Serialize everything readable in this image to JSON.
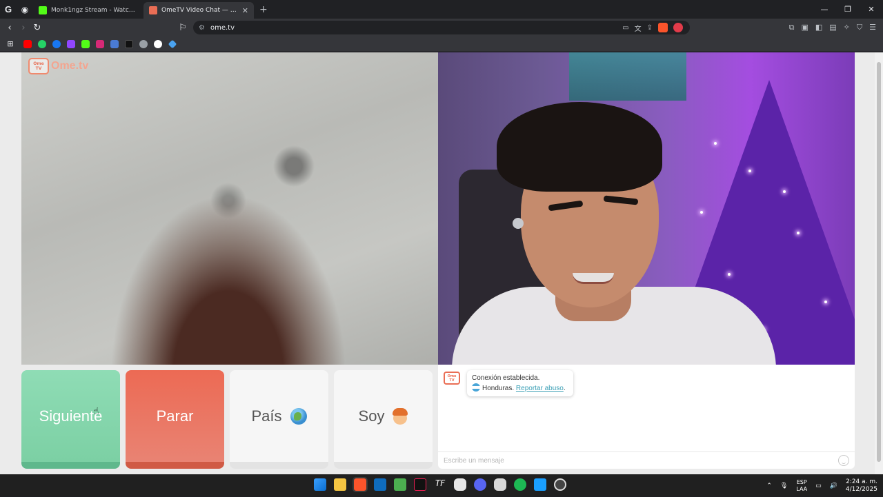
{
  "browser": {
    "tabs": [
      {
        "title": "Monk1ngz Stream - Watch Live o",
        "active": false
      },
      {
        "title": "OmeTV Video Chat — Omegl",
        "active": true
      }
    ],
    "new_tab_symbol": "+",
    "url": "ome.tv"
  },
  "ometv": {
    "logo_small": "Ome TV",
    "logo_text": "Ome.tv",
    "buttons": {
      "next": "Siguiente",
      "stop": "Parar",
      "country": "País",
      "gender": "Soy"
    },
    "chat": {
      "status": "Conexión establecida.",
      "country": "Honduras.",
      "report_link": "Reportar abuso",
      "report_suffix": ".",
      "input_placeholder": "Escribe un mensaje"
    }
  },
  "taskbar": {
    "language_top": "ESP",
    "language_bottom": "LAA",
    "time": "2:24 a. m.",
    "date": "4/12/2025"
  },
  "colors": {
    "next_button": "#7cd0a4",
    "stop_button": "#e9735e",
    "neutral_button": "#f6f6f6",
    "link": "#3a9fb5"
  }
}
